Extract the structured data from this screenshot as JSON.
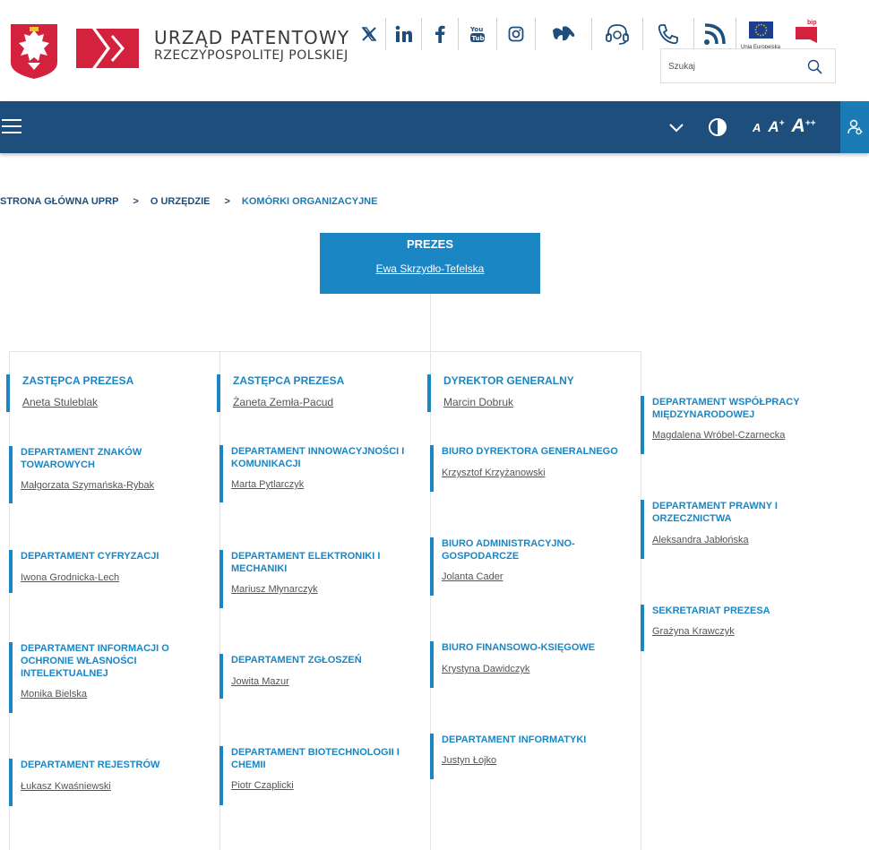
{
  "header": {
    "logo_line1": "URZĄD PATENTOWY",
    "logo_line2": "RZECZYPOSPOLITEJ POLSKIEJ",
    "eu_label": "Unia Europejska",
    "bip_label": "bip",
    "search_placeholder": "Szukaj"
  },
  "social_icons": [
    "x-icon",
    "linkedin-icon",
    "facebook-icon",
    "youtube-icon",
    "instagram-icon",
    "sign-language-icon",
    "headset-icon",
    "phone-icon",
    "rss-icon"
  ],
  "navbar": {
    "font_small": "A",
    "font_medium": "A",
    "font_medium_sup": "+",
    "font_large": "A",
    "font_large_sup": "++"
  },
  "breadcrumb": {
    "home": "STRONA GŁÓWNA UPRP",
    "sep": ">",
    "level1": "O URZĘDZIE",
    "current": "KOMÓRKI ORGANIZACYJNE"
  },
  "president": {
    "title": "PREZES",
    "name": "Ewa Skrzydło-Tefelska"
  },
  "columns": [
    {
      "head": {
        "title": "ZASTĘPCA PREZESA",
        "name": "Aneta Stuleblak"
      },
      "units": [
        {
          "title": "DEPARTAMENT ZNAKÓW TOWAROWYCH",
          "name": "Małgorzata Szymańska-Rybak"
        },
        {
          "title": "DEPARTAMENT CYFRYZACJI",
          "name": "Iwona Grodnicka-Lech"
        },
        {
          "title": "DEPARTAMENT INFORMACJI O OCHRONIE WŁASNOŚCI INTELEKTUALNEJ",
          "name": "Monika Bielska"
        },
        {
          "title": "DEPARTAMENT REJESTRÓW",
          "name": "Łukasz Kwaśniewski"
        }
      ]
    },
    {
      "head": {
        "title": "ZASTĘPCA PREZESA",
        "name": "Żaneta Zemła-Pacud"
      },
      "units": [
        {
          "title": "DEPARTAMENT INNOWACYJNOŚCI I KOMUNIKACJI",
          "name": "Marta Pytlarczyk"
        },
        {
          "title": "DEPARTAMENT ELEKTRONIKI I MECHANIKI",
          "name": "Mariusz Młynarczyk"
        },
        {
          "title": "DEPARTAMENT ZGŁOSZEŃ",
          "name": "Jowita Mazur"
        },
        {
          "title": "DEPARTAMENT BIOTECHNOLOGII I CHEMII",
          "name": "Piotr Czaplicki"
        }
      ]
    },
    {
      "head": {
        "title": "DYREKTOR GENERALNY",
        "name": "Marcin Dobruk"
      },
      "units": [
        {
          "title": "BIURO DYREKTORA GENERALNEGO",
          "name": "Krzysztof Krzyżanowski"
        },
        {
          "title": "BIURO ADMINISTRACYJNO-GOSPODARCZE",
          "name": "Jolanta Cader"
        },
        {
          "title": "BIURO FINANSOWO-KSIĘGOWE",
          "name": "Krystyna Dawidczyk"
        },
        {
          "title": "DEPARTAMENT INFORMATYKI",
          "name": "Justyn Łojko"
        }
      ]
    },
    {
      "units": [
        {
          "title": "DEPARTAMENT WSPÓŁPRACY MIĘDZYNARODOWEJ",
          "name": "Magdalena Wróbel-Czarnecka"
        },
        {
          "title": "DEPARTAMENT PRAWNY I ORZECZNICTWA",
          "name": "Aleksandra Jabłońska"
        },
        {
          "title": "SEKRETARIAT PREZESA",
          "name": "Grażyna Krawczyk"
        }
      ]
    }
  ],
  "colors": {
    "navbar": "#1e4e7c",
    "accent": "#1a86c4",
    "a11y_button": "#1a7bb5"
  }
}
